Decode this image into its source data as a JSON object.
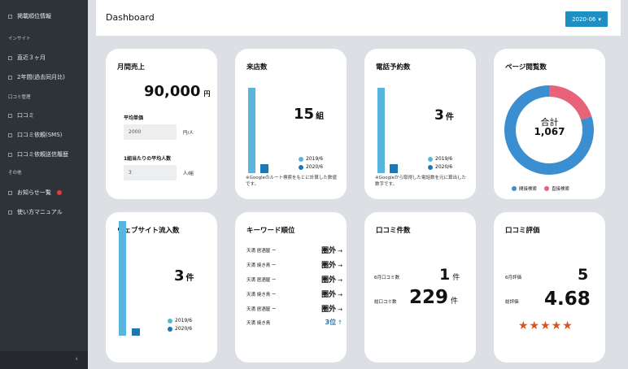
{
  "sidebar": {
    "items": [
      {
        "label": "掲載順位情報"
      },
      {
        "label": "直近３ヶ月"
      },
      {
        "label": "2年間(過去同月比)"
      },
      {
        "label": "口コミ"
      },
      {
        "label": "口コミ依頼(SMS)"
      },
      {
        "label": "口コミ依頼送信履歴"
      },
      {
        "label": "お知らせ一覧"
      },
      {
        "label": "使い方マニュアル"
      }
    ],
    "sections": [
      "インサイト",
      "口コミ管理",
      "その他"
    ],
    "collapse_icon": "‹"
  },
  "header": {
    "title": "Dashboard",
    "month": "2020-06",
    "month_caret": "▾"
  },
  "sales": {
    "title": "月間売上",
    "amount": "90,000",
    "unit": "円",
    "avg_price_label": "平均単価",
    "avg_price_value": "2000",
    "avg_price_unit": "円/人",
    "group_avg_label": "1組当たりの平均人数",
    "group_avg_value": "3",
    "group_avg_unit": "人/組"
  },
  "visits": {
    "title": "来店数",
    "value": "15",
    "unit": "組",
    "legend": [
      "2019/6",
      "2020/6"
    ],
    "bars": [
      0.95,
      0.1
    ],
    "note": "※Googleのルート検索をもとに計算した数値です。"
  },
  "calls": {
    "title": "電話予約数",
    "value": "3",
    "unit": "件",
    "legend": [
      "2019/6",
      "2020/6"
    ],
    "bars": [
      0.95,
      0.1
    ],
    "note": "※Googleから取得した電話数を元に算出した数字です。"
  },
  "pageviews": {
    "title": "ページ閲覧数",
    "total_label": "合計",
    "total": "1,067",
    "legend": [
      "間接検索",
      "直接検索"
    ],
    "share_indirect": 0.8,
    "colors": {
      "indirect": "#3b8fd0",
      "direct": "#e8637a"
    }
  },
  "web": {
    "title": "ウェブサイト流入数",
    "value": "3",
    "unit": "件",
    "legend": [
      "2019/6",
      "2020/6"
    ],
    "bars": [
      0.95,
      0.06
    ]
  },
  "keywords": {
    "title": "キーワード順位",
    "rows": [
      {
        "keyword": "天満 居酒屋 ー",
        "rank": "圏外",
        "arrow": "→",
        "blue": false
      },
      {
        "keyword": "天満 焼き鳥 ー",
        "rank": "圏外",
        "arrow": "→",
        "blue": false
      },
      {
        "keyword": "天満 居酒屋 ー",
        "rank": "圏外",
        "arrow": "→",
        "blue": false
      },
      {
        "keyword": "天満 焼き鳥 ー",
        "rank": "圏外",
        "arrow": "→",
        "blue": false
      },
      {
        "keyword": "天満 居酒屋 ー",
        "rank": "圏外",
        "arrow": "→",
        "blue": false
      },
      {
        "keyword": "天満 焼き鳥",
        "rank": "3位",
        "arrow": "↑",
        "blue": true
      }
    ]
  },
  "reviews": {
    "title": "口コミ件数",
    "month_label": "6月口コミ数",
    "month_value": "1",
    "total_label": "総口コミ数",
    "total_value": "229",
    "unit": "件"
  },
  "rating": {
    "title": "口コミ評価",
    "month_label": "6月評価",
    "month_value": "5",
    "total_label": "総評価",
    "total_value": "4.68",
    "stars": "★★★★★"
  },
  "colors": {
    "accent": "#1e8fc2",
    "bar_light": "#5ab5dd",
    "bar_dark": "#1f77b4",
    "sidebar": "#2d3338"
  }
}
